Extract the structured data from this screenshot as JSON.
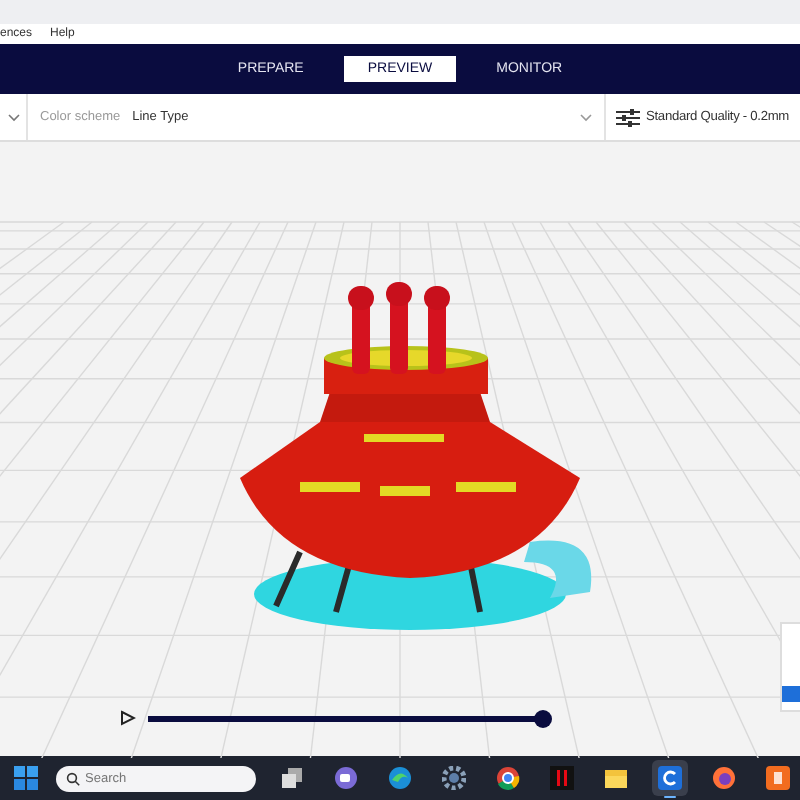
{
  "menu": [
    {
      "label": "ences"
    },
    {
      "label": "Help"
    }
  ],
  "stages": [
    {
      "label": "PREPARE",
      "selected": false
    },
    {
      "label": "PREVIEW",
      "selected": true
    },
    {
      "label": "MONITOR",
      "selected": false
    }
  ],
  "toolbar": {
    "color_scheme_label": "Color scheme",
    "color_scheme_value": "Line Type",
    "profile": "Standard Quality - 0.2mm"
  },
  "simulation": {
    "level": 1
  },
  "taskbar": {
    "search_placeholder": "Search",
    "apps": [
      {
        "kind": "taskview",
        "selected": false
      },
      {
        "kind": "chat",
        "selected": false
      },
      {
        "kind": "edge",
        "selected": false
      },
      {
        "kind": "settings",
        "selected": false
      },
      {
        "kind": "chrome",
        "selected": false
      },
      {
        "kind": "netflix",
        "selected": false
      },
      {
        "kind": "folder",
        "selected": false
      },
      {
        "kind": "cura",
        "selected": true
      },
      {
        "kind": "firefox",
        "selected": false
      },
      {
        "kind": "orange",
        "selected": false
      }
    ]
  }
}
